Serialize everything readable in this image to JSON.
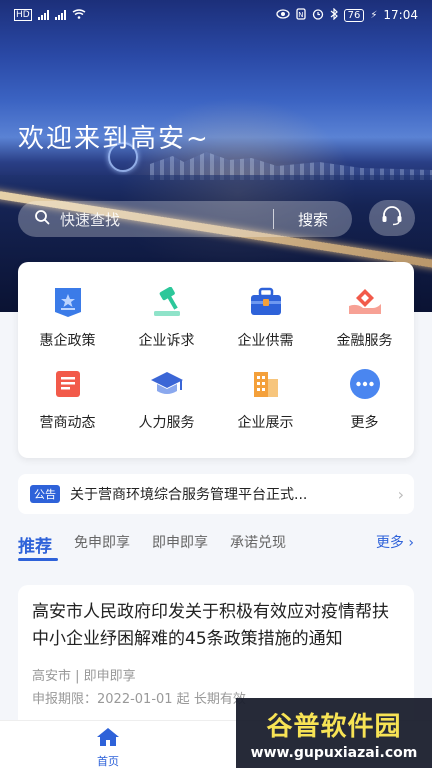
{
  "status_bar": {
    "network": "HD",
    "battery": "76",
    "time": "17:04"
  },
  "hero": {
    "welcome_text": "欢迎来到高安~"
  },
  "search": {
    "placeholder": "快速查找",
    "button_label": "搜索"
  },
  "services": [
    {
      "label": "惠企政策",
      "icon": "policy-icon",
      "color": "#3b7be8"
    },
    {
      "label": "企业诉求",
      "icon": "gavel-icon",
      "color": "#2cc79a"
    },
    {
      "label": "企业供需",
      "icon": "toolbox-icon",
      "color": "#2e62d9"
    },
    {
      "label": "金融服务",
      "icon": "finance-icon",
      "color": "#f25a4a"
    },
    {
      "label": "营商动态",
      "icon": "news-icon",
      "color": "#f25a4a"
    },
    {
      "label": "人力服务",
      "icon": "graduation-cap-icon",
      "color": "#3b66d6"
    },
    {
      "label": "企业展示",
      "icon": "buildings-icon",
      "color": "#f4a03a"
    },
    {
      "label": "更多",
      "icon": "more-icon",
      "color": "#4a86f0"
    }
  ],
  "notice": {
    "tag": "公告",
    "text": "关于营商环境综合服务管理平台正式..."
  },
  "tabs": {
    "items": [
      "推荐",
      "免申即享",
      "即申即享",
      "承诺兑现"
    ],
    "more_label": "更多"
  },
  "article": {
    "title": "高安市人民政府印发关于积极有效应对疫情帮扶中小企业纾困解难的45条政策措施的通知",
    "source": "高安市 | 即申即享",
    "period": "申报期限：2022-01-01 起 长期有效"
  },
  "bottom_nav": {
    "home_label": "首页"
  },
  "watermark": {
    "brand": "谷普软件园",
    "url": "www.gupuxiazai.com"
  },
  "colors": {
    "accent": "#2e62d9"
  }
}
